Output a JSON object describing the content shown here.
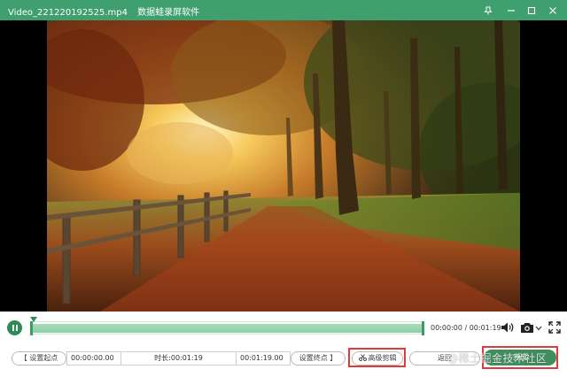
{
  "window": {
    "filename": "Video_221220192525.mp4",
    "app_name": "数据蛙录屏软件"
  },
  "colors": {
    "brand_green": "#3f9f6e",
    "highlight_red": "#e23a3a"
  },
  "playback": {
    "state": "playing",
    "current_time": "00:00:00",
    "total_time": "00:01:19",
    "progress_fraction": 0.0,
    "timecode_separator": " / "
  },
  "trim": {
    "set_start_label": "【 设置起点",
    "start_time": "00:00:00.00",
    "duration_label": "时长:",
    "duration_value": "00:01:19",
    "end_time": "00:01:19.00",
    "set_end_label": "设置终点 】",
    "advanced_edit_label": "高级剪辑"
  },
  "actions": {
    "back_label": "返回",
    "finish_label": "完成"
  },
  "watermark": "@稀土掘金技术社区",
  "icons": {
    "volume": "speaker-icon",
    "snapshot": "camera-icon",
    "fullscreen": "expand-icon",
    "advanced_edit": "scissors-icon"
  }
}
